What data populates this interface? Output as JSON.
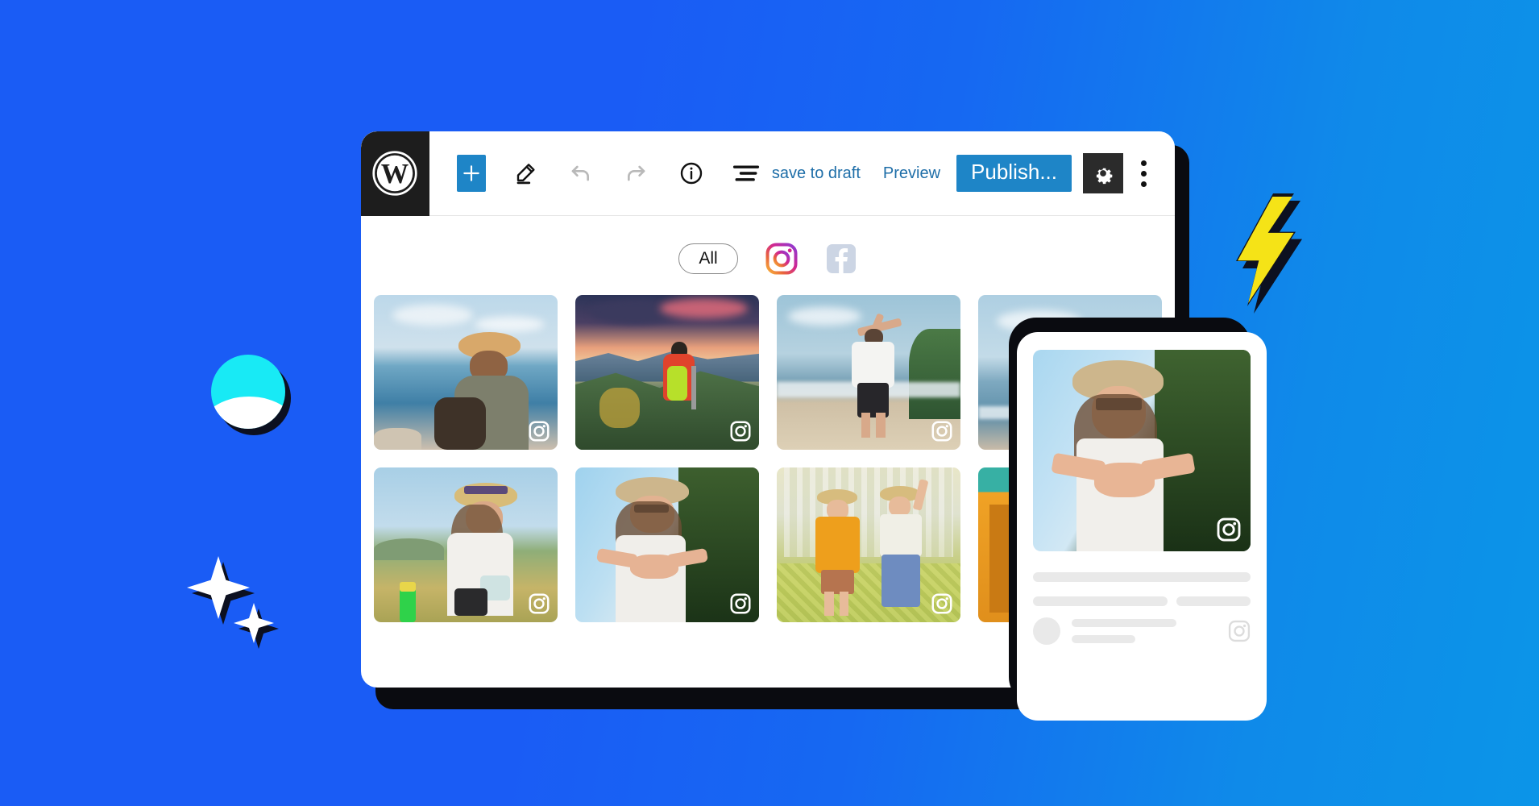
{
  "background": {
    "color_left": "#1a5cf5",
    "color_right": "#0b95e8"
  },
  "decorations": [
    {
      "name": "cyan-circle",
      "colors": [
        "#18eaf5",
        "#ffffff",
        "#0c1020"
      ]
    },
    {
      "name": "sparkle-large",
      "color": "#ffffff"
    },
    {
      "name": "sparkle-small",
      "color": "#ffffff"
    },
    {
      "name": "lightning-bolt",
      "color": "#f5e317",
      "outline": "#12131a"
    }
  ],
  "browser": {
    "toolbar": {
      "logo_icon": "wordpress-logo-icon",
      "add_block_icon": "plus-icon",
      "edit_icon": "pencil-icon",
      "undo_icon": "undo-arrow-icon",
      "redo_icon": "redo-arrow-icon",
      "info_icon": "info-circle-icon",
      "outline_icon": "list-view-icon",
      "save_draft_label": "save to draft",
      "preview_label": "Preview",
      "publish_label": "Publish...",
      "settings_icon": "gear-icon",
      "more_icon": "kebab-menu-icon",
      "accent_color": "#1e85c7",
      "link_color": "#1e6ea8"
    },
    "feed": {
      "filters": [
        {
          "id": "all",
          "label": "All",
          "type": "pill",
          "active": true
        },
        {
          "id": "instagram",
          "label": "Instagram",
          "type": "icon",
          "icon": "instagram-icon",
          "active": false
        },
        {
          "id": "facebook",
          "label": "Facebook",
          "type": "icon",
          "icon": "facebook-icon",
          "active": false
        }
      ],
      "badge_icon": "instagram-badge-icon",
      "posts": [
        {
          "id": 1,
          "alt": "Man in straw hat with backpack by the ocean",
          "source": "instagram"
        },
        {
          "id": 2,
          "alt": "Hiker in red jacket overlooking mountain valley at sunset",
          "source": "instagram"
        },
        {
          "id": 3,
          "alt": "Man cheering with arms raised on a beach",
          "source": "instagram"
        },
        {
          "id": 4,
          "alt": "Person looking out at the sea",
          "source": "instagram"
        },
        {
          "id": 5,
          "alt": "Woman in straw hat holding a mug in a meadow",
          "source": "instagram"
        },
        {
          "id": 6,
          "alt": "Woman in straw hat making a heart with her hands",
          "source": "instagram"
        },
        {
          "id": 7,
          "alt": "Two women walking together among yellow flowers",
          "source": "instagram"
        },
        {
          "id": 8,
          "alt": "Orange building facade",
          "source": "instagram"
        }
      ]
    }
  },
  "phone_preview": {
    "photo_alt": "Woman in straw hat making a heart with her hands",
    "badge_icon": "instagram-badge-icon",
    "footer_icon": "instagram-icon",
    "avatar_icon": "avatar-placeholder",
    "skeleton_lines": 5
  }
}
